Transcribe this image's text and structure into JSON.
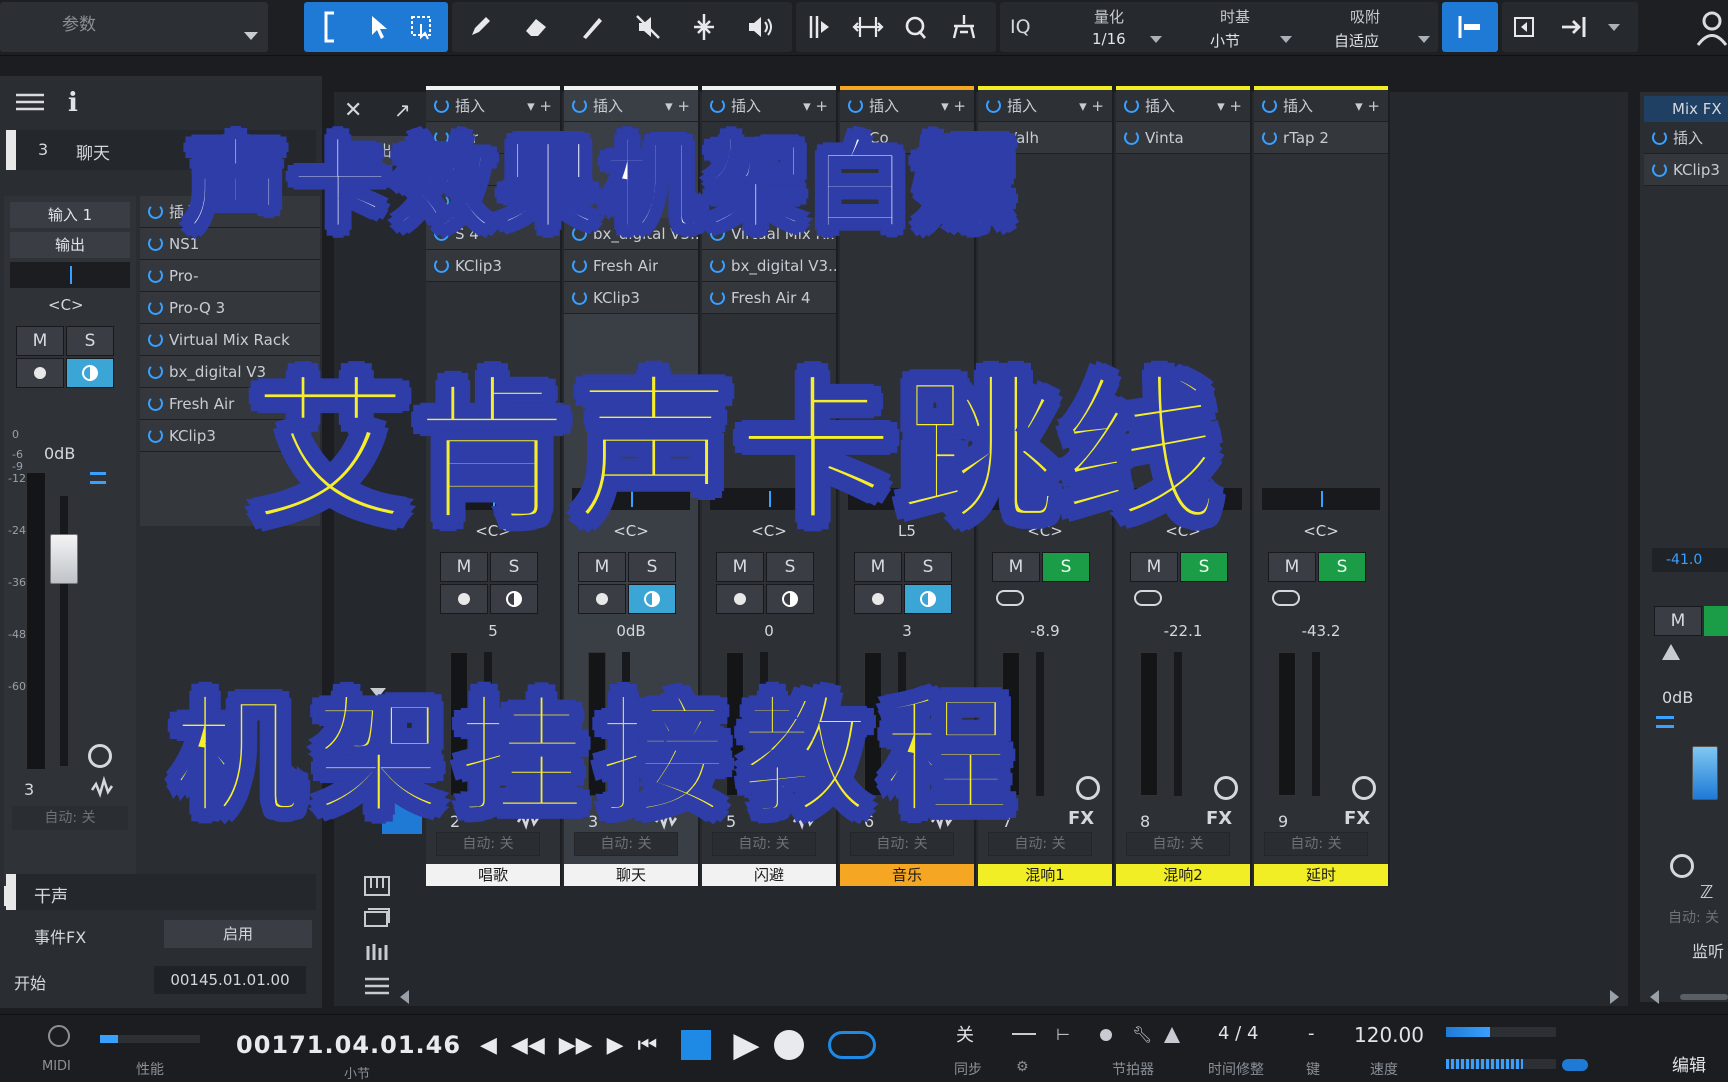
{
  "toolbar": {
    "params_label": "参数",
    "iq_label": "IQ",
    "quantize": {
      "label": "量化",
      "value": "1/16"
    },
    "timebase": {
      "label": "时基",
      "value": "小节"
    },
    "snap": {
      "label": "吸附",
      "value": "自适应"
    }
  },
  "left": {
    "channel_num": "3",
    "channel_name": "聊天",
    "input": "输入 1",
    "output": "输出",
    "pan": "<C>",
    "mute": "M",
    "solo": "S",
    "gain": "0dB",
    "number": "3",
    "auto": "自动: 关",
    "bottom_name": "聊天",
    "scale": [
      "0",
      "-6",
      "-9",
      "-12",
      "-24",
      "-36",
      "-48",
      "-60"
    ],
    "inserts_label": "插入",
    "inserts": [
      "NS1",
      "Pro-",
      "Pro-Q 3",
      "Virtual Mix Rack",
      "bx_digital V3",
      "Fresh Air",
      "KClip3"
    ],
    "dry_label": "干声",
    "event_fx": "事件FX",
    "enable": "启用",
    "start_label": "开始",
    "start_value": "00145.01.01.00"
  },
  "console": {
    "io_label": "入/输出",
    "channels": [
      {
        "name": "唱歌",
        "num": "2",
        "pan": "<C>",
        "gain": "5",
        "inserts": [
          "ser",
          "3",
          "Air",
          "S 4",
          "KClip3"
        ],
        "solo_green": false,
        "color": "#f2f2f2",
        "type_icon": "wave"
      },
      {
        "name": "聊天",
        "num": "3",
        "pan": "<C>",
        "gain": "0dB",
        "inserts": [
          "",
          "",
          "",
          "bx_digital V3...",
          "Fresh Air",
          "KClip3"
        ],
        "solo_green": false,
        "color": "#f2f2f2",
        "type_icon": "wave"
      },
      {
        "name": "闪避",
        "num": "5",
        "pan": "<C>",
        "gain": "0",
        "inserts": [
          "",
          "",
          "",
          "Virtual Mix R...",
          "bx_digital V3...",
          "Fresh Air 4"
        ],
        "solo_green": false,
        "color": "#f2f2f2",
        "type_icon": "wave"
      },
      {
        "name": "音乐",
        "num": "6",
        "pan": "L5",
        "gain": "3",
        "inserts": [
          "Co"
        ],
        "solo_green": false,
        "color": "#f5a623",
        "type_icon": "wave"
      },
      {
        "name": "混响1",
        "num": "7",
        "pan": "<C>",
        "gain": "-8.9",
        "inserts": [
          "Valh"
        ],
        "solo_green": true,
        "color": "#f2ee25",
        "type_icon": "FX"
      },
      {
        "name": "混响2",
        "num": "8",
        "pan": "<C>",
        "gain": "-22.1",
        "inserts": [
          "Vinta"
        ],
        "solo_green": true,
        "color": "#f2ee25",
        "type_icon": "FX"
      },
      {
        "name": "延时",
        "num": "9",
        "pan": "<C>",
        "gain": "-43.2",
        "inserts": [
          "rTap 2"
        ],
        "solo_green": true,
        "color": "#f2ee25",
        "type_icon": "FX"
      }
    ],
    "insert_label": "插入",
    "mute": "M",
    "solo": "S",
    "auto": "自动: 关"
  },
  "right": {
    "mixfx": "Mix FX",
    "insert_label": "插入",
    "insert1": "KClip3",
    "level": "-41.0",
    "gain": "0dB",
    "auto": "自动: 关",
    "monitor": "监听",
    "mute": "M"
  },
  "transport": {
    "midi": "MIDI",
    "perf": "性能",
    "time": "00171.04.01.46",
    "time_unit": "小节",
    "sync": "关",
    "sync_label": "同步",
    "metronome": "节拍器",
    "time_sig": "4 / 4",
    "time_correct": "时间修整",
    "key": "-",
    "key_label": "键",
    "tempo": "120.00",
    "tempo_label": "速度",
    "edit": "编辑"
  },
  "overlay": {
    "line1": "声卡效果机架白嫖",
    "line2": "艾肯声卡跳线",
    "line3": "机架挂接教程"
  },
  "colors": {
    "accent": "#1f7ad6",
    "overlay_blue": "#2f3da8",
    "overlay_yellow": "#f6ee2a"
  }
}
